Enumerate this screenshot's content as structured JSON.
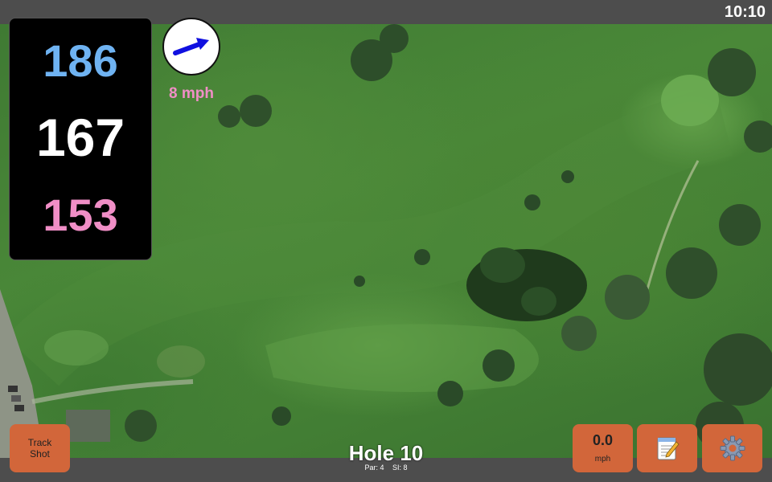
{
  "status_bar": {
    "time": "10:10"
  },
  "distances": {
    "back": "186",
    "middle": "167",
    "front": "153",
    "back_color": "#6fb3f2",
    "middle_color": "#ffffff",
    "front_color": "#f08ec6"
  },
  "wind": {
    "speed_label": "8 mph",
    "direction_icon": "arrow-icon",
    "direction": "east-northeast"
  },
  "buttons": {
    "track_shot_line1": "Track",
    "track_shot_line2": "Shot",
    "speed_value": "0.0",
    "speed_unit": "mph",
    "notes_icon": "notepad-icon",
    "settings_icon": "gear-icon",
    "accent_color": "#d2663a"
  },
  "hole": {
    "title": "Hole 10",
    "par": "Par: 4",
    "si": "SI: 8"
  }
}
